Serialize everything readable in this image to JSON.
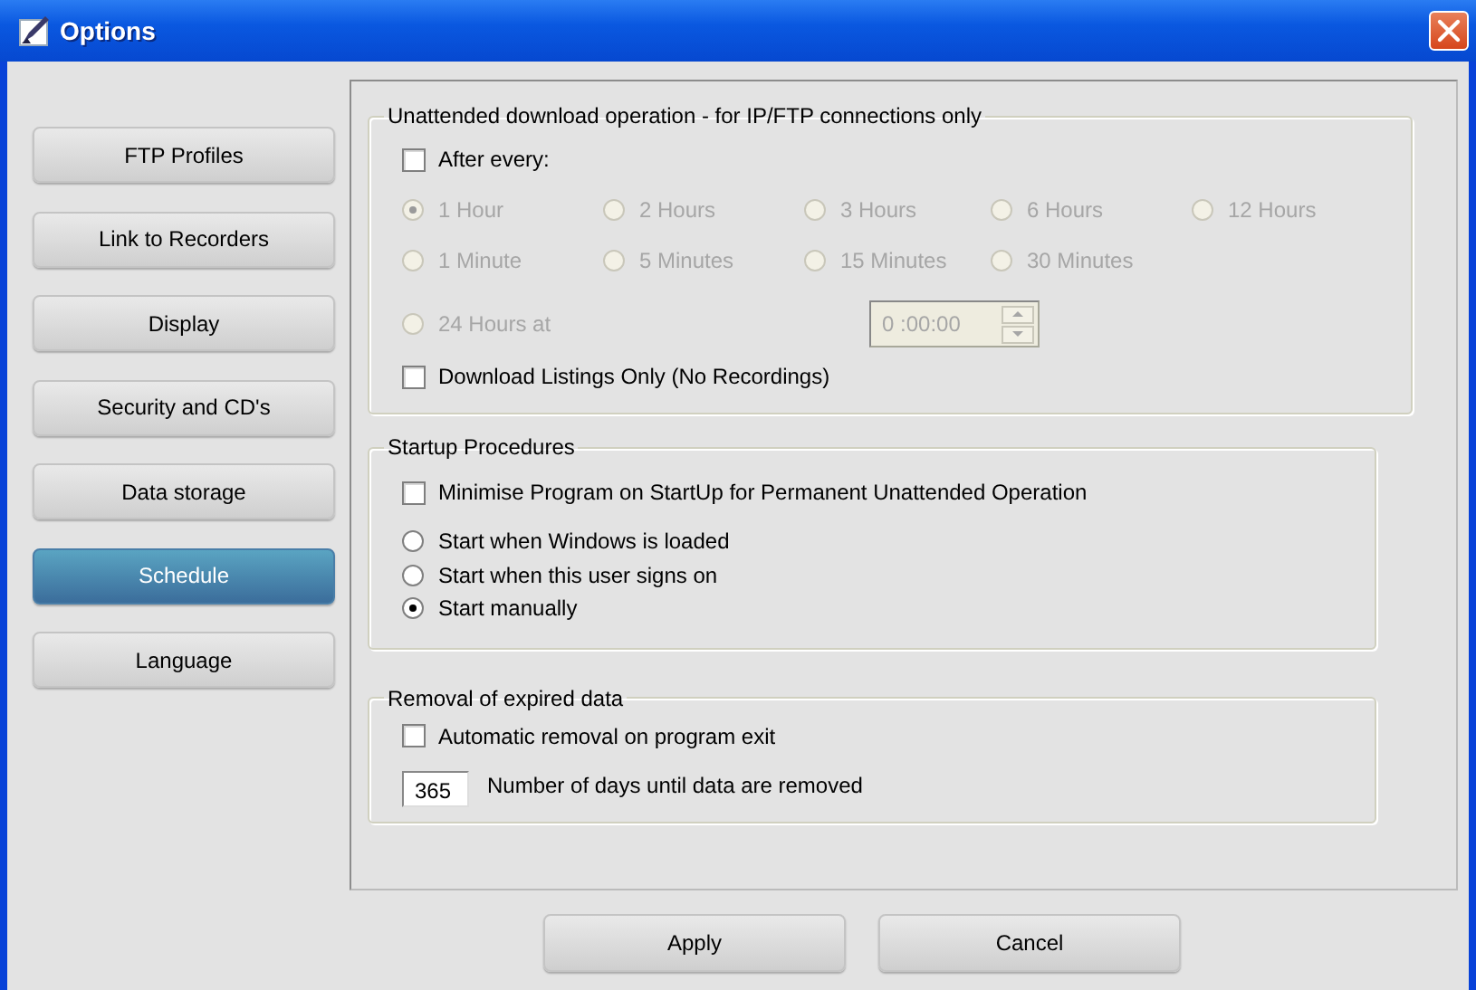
{
  "window": {
    "title": "Options"
  },
  "sidebar": {
    "items": [
      {
        "label": "FTP Profiles",
        "selected": false
      },
      {
        "label": "Link to Recorders",
        "selected": false
      },
      {
        "label": "Display",
        "selected": false
      },
      {
        "label": "Security and CD's",
        "selected": false
      },
      {
        "label": "Data storage",
        "selected": false
      },
      {
        "label": "Schedule",
        "selected": true
      },
      {
        "label": "Language",
        "selected": false
      }
    ]
  },
  "unattended": {
    "title": "Unattended download operation - for IP/FTP connections only",
    "after_every": {
      "label": "After every:",
      "checked": false
    },
    "intervals": [
      {
        "label": "1 Hour",
        "selected": true,
        "disabled": true
      },
      {
        "label": "2 Hours",
        "selected": false,
        "disabled": true
      },
      {
        "label": "3 Hours",
        "selected": false,
        "disabled": true
      },
      {
        "label": "6 Hours",
        "selected": false,
        "disabled": true
      },
      {
        "label": "12 Hours",
        "selected": false,
        "disabled": true
      },
      {
        "label": "1 Minute",
        "selected": false,
        "disabled": true
      },
      {
        "label": "5 Minutes",
        "selected": false,
        "disabled": true
      },
      {
        "label": "15 Minutes",
        "selected": false,
        "disabled": true
      },
      {
        "label": "30 Minutes",
        "selected": false,
        "disabled": true
      }
    ],
    "daily": {
      "label": "24 Hours at",
      "selected": false,
      "disabled": true
    },
    "time": {
      "value": "0 :00:00",
      "disabled": true
    },
    "listings_only": {
      "label": "Download Listings Only (No Recordings)",
      "checked": false
    }
  },
  "startup": {
    "title": "Startup Procedures",
    "minimise": {
      "label": "Minimise Program on StartUp for Permanent Unattended Operation",
      "checked": false
    },
    "options": [
      {
        "label": "Start when Windows is loaded",
        "selected": false,
        "disabled": false
      },
      {
        "label": "Start when this user signs on",
        "selected": false,
        "disabled": false
      },
      {
        "label": "Start manually",
        "selected": true,
        "disabled": false
      }
    ]
  },
  "removal": {
    "title": "Removal of expired data",
    "auto_remove": {
      "label": "Automatic removal on program exit",
      "checked": false
    },
    "days": {
      "value": "365",
      "label": "Number of days until data are removed"
    }
  },
  "buttons": [
    {
      "label": "Apply"
    },
    {
      "label": "Cancel"
    }
  ]
}
